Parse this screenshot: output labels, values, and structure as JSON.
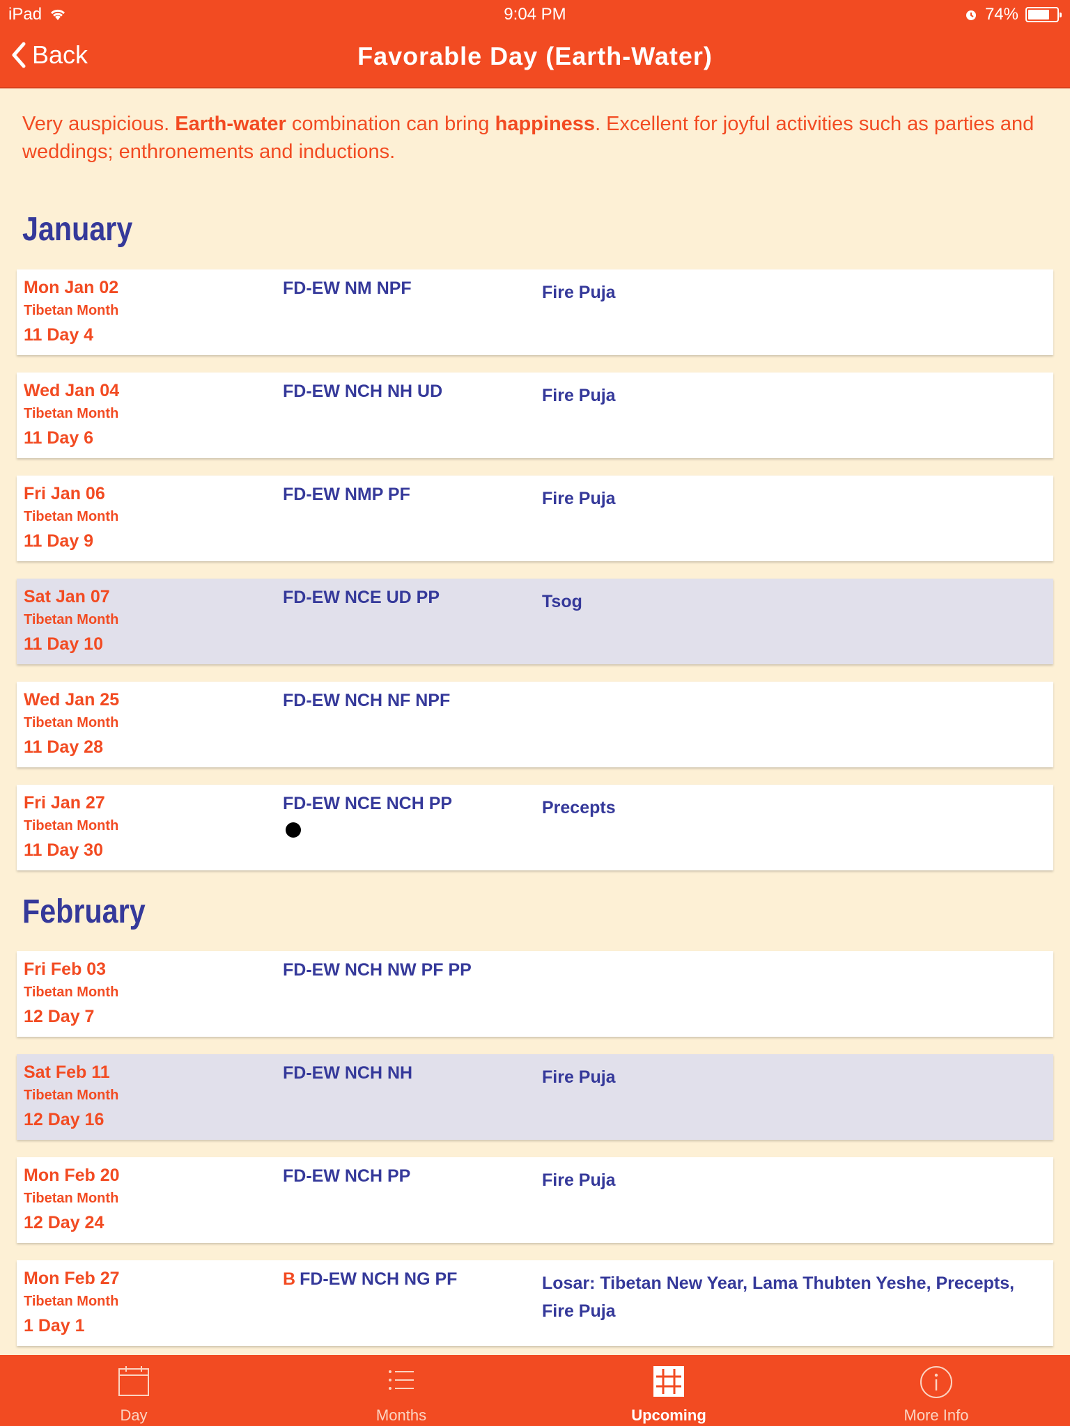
{
  "status_bar": {
    "carrier": "iPad",
    "time": "9:04 PM",
    "battery": "74%",
    "battery_level": 0.74
  },
  "nav": {
    "back_label": "Back",
    "title": "Favorable Day (Earth-Water)"
  },
  "description": {
    "p1": "Very auspicious. ",
    "b1": "Earth-water",
    "p2": " combination can bring ",
    "b2": "happiness",
    "p3": ". Excellent for joyful activities such as parties and weddings; enthronements and inductions."
  },
  "months": [
    {
      "name": "January",
      "rows": [
        {
          "date": "Mon Jan 02",
          "tib": "Tibetan Month",
          "day": "11 Day 4",
          "prefix": "",
          "codes": "FD-EW NM NPF",
          "event": "Fire Puja",
          "highlight": false,
          "dot": false
        },
        {
          "date": "Wed Jan 04",
          "tib": "Tibetan Month",
          "day": "11 Day 6",
          "prefix": "",
          "codes": "FD-EW NCH NH UD",
          "event": "Fire Puja",
          "highlight": false,
          "dot": false
        },
        {
          "date": "Fri Jan 06",
          "tib": "Tibetan Month",
          "day": "11 Day 9",
          "prefix": "",
          "codes": "FD-EW NMP PF",
          "event": "Fire Puja",
          "highlight": false,
          "dot": false
        },
        {
          "date": "Sat Jan 07",
          "tib": "Tibetan Month",
          "day": "11 Day 10",
          "prefix": "",
          "codes": "FD-EW NCE UD PP",
          "event": "Tsog",
          "highlight": true,
          "dot": false
        },
        {
          "date": "Wed Jan 25",
          "tib": "Tibetan Month",
          "day": "11 Day 28",
          "prefix": "",
          "codes": "FD-EW NCH NF NPF",
          "event": "",
          "highlight": false,
          "dot": false
        },
        {
          "date": "Fri Jan 27",
          "tib": "Tibetan Month",
          "day": "11 Day 30",
          "prefix": "",
          "codes": "FD-EW NCE NCH PP",
          "event": "Precepts",
          "highlight": false,
          "dot": true
        }
      ]
    },
    {
      "name": "February",
      "rows": [
        {
          "date": "Fri Feb 03",
          "tib": "Tibetan Month",
          "day": "12 Day 7",
          "prefix": "",
          "codes": "FD-EW NCH NW PF PP",
          "event": "",
          "highlight": false,
          "dot": false
        },
        {
          "date": "Sat Feb 11",
          "tib": "Tibetan Month",
          "day": "12 Day 16",
          "prefix": "",
          "codes": "FD-EW NCH NH",
          "event": "Fire Puja",
          "highlight": true,
          "dot": false
        },
        {
          "date": "Mon Feb 20",
          "tib": "Tibetan Month",
          "day": "12 Day 24",
          "prefix": "",
          "codes": "FD-EW NCH PP",
          "event": "Fire Puja",
          "highlight": false,
          "dot": false
        },
        {
          "date": "Mon Feb 27",
          "tib": "Tibetan Month",
          "day": "1 Day 1",
          "prefix": "B",
          "codes": "FD-EW NCH NG PF",
          "event": "Losar: Tibetan New Year, Lama Thubten Yeshe, Precepts, Fire Puja",
          "highlight": false,
          "dot": false
        }
      ]
    }
  ],
  "tabs": [
    {
      "label": "Day",
      "icon": "calendar-icon",
      "active": false
    },
    {
      "label": "Months",
      "icon": "list-icon",
      "active": false
    },
    {
      "label": "Upcoming",
      "icon": "grid-icon",
      "active": true
    },
    {
      "label": "More Info",
      "icon": "info-icon",
      "active": false
    }
  ],
  "colors": {
    "accent": "#f24b22",
    "navy": "#35399a",
    "background": "#fdf0d5",
    "highlight_row": "#e1e0eb"
  }
}
